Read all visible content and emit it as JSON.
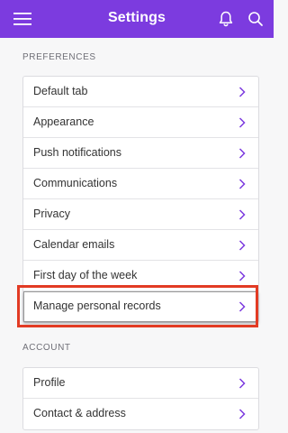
{
  "header": {
    "title": "Settings",
    "menu_icon": "hamburger-menu-icon",
    "notification_icon": "bell-icon",
    "search_icon": "search-icon",
    "background_color": "#7c3bdf"
  },
  "sections": [
    {
      "label": "PREFERENCES",
      "items": [
        {
          "label": "Default tab"
        },
        {
          "label": "Appearance"
        },
        {
          "label": "Push notifications"
        },
        {
          "label": "Communications"
        },
        {
          "label": "Privacy"
        },
        {
          "label": "Calendar emails"
        },
        {
          "label": "First day of the week"
        },
        {
          "label": "Manage personal records",
          "highlighted": true
        }
      ]
    },
    {
      "label": "ACCOUNT",
      "items": [
        {
          "label": "Profile"
        },
        {
          "label": "Contact & address"
        }
      ]
    }
  ],
  "highlight_color": "#e23b24",
  "chevron_color": "#7c3bdf"
}
